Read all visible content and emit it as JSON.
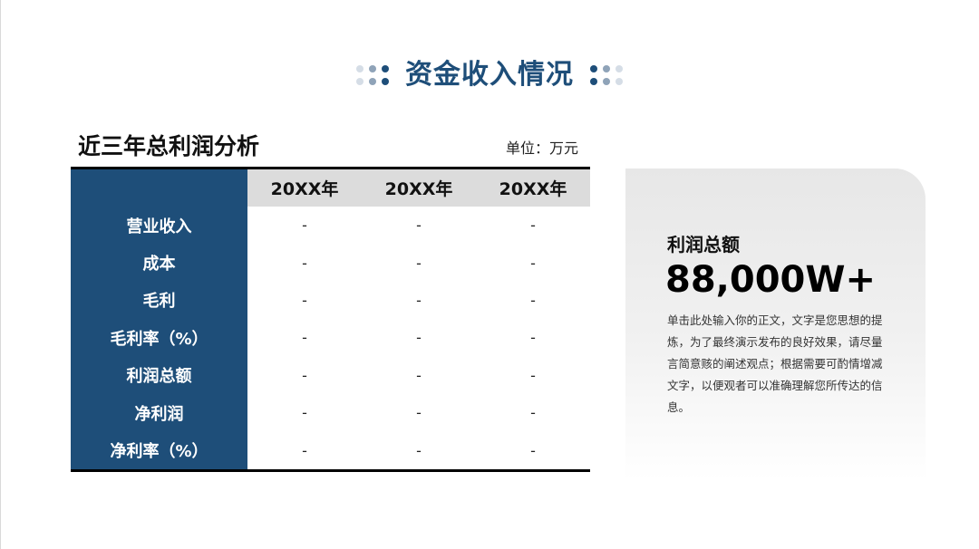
{
  "header": {
    "title": "资金收入情况"
  },
  "table_section": {
    "title": "近三年总利润分析",
    "unit": "单位：万元",
    "columns": [
      "20XX年",
      "20XX年",
      "20XX年"
    ],
    "rows": [
      {
        "label": "营业收入",
        "values": [
          "-",
          "-",
          "-"
        ]
      },
      {
        "label": "成本",
        "values": [
          "-",
          "-",
          "-"
        ]
      },
      {
        "label": "毛利",
        "values": [
          "-",
          "-",
          "-"
        ]
      },
      {
        "label": "毛利率（%）",
        "values": [
          "-",
          "-",
          "-"
        ]
      },
      {
        "label": "利润总额",
        "values": [
          "-",
          "-",
          "-"
        ]
      },
      {
        "label": "净利润",
        "values": [
          "-",
          "-",
          "-"
        ]
      },
      {
        "label": "净利率（%）",
        "values": [
          "-",
          "-",
          "-"
        ]
      }
    ]
  },
  "summary_card": {
    "label": "利润总额",
    "value": "88,000W+",
    "description": "单击此处输入你的正文，文字是您思想的提炼，为了最终演示发布的良好效果，请尽量言简意赅的阐述观点；根据需要可酌情增减文字，以便观者可以准确理解您所传达的信息。"
  },
  "colors": {
    "accent": "#1e4e79",
    "header_gray": "#dcdcdc",
    "dot_light": "#d5dde6",
    "dot_mid": "#8fa3b8"
  }
}
